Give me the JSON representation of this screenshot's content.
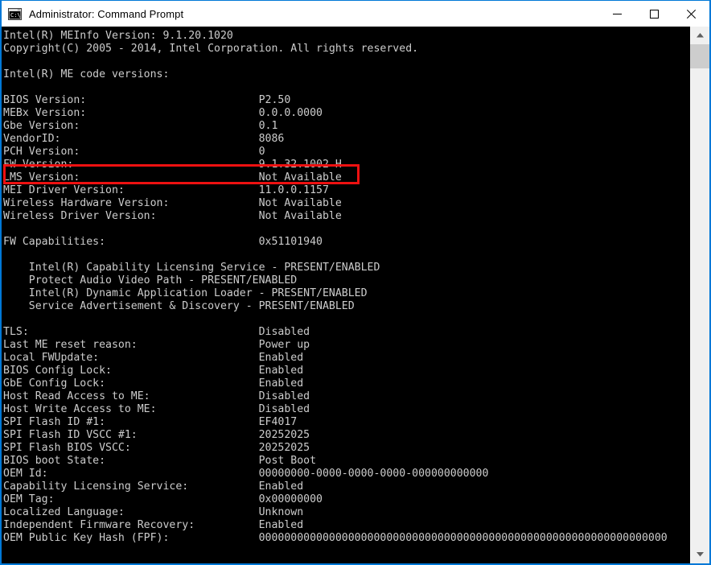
{
  "window": {
    "title": "Administrator: Command Prompt",
    "icon": "command-prompt-icon",
    "border_color": "#0078d7",
    "titlebar_bg": "#ffffff",
    "console_bg": "#000000",
    "console_fg": "#cccccc"
  },
  "caption_buttons": {
    "minimize_label": "Minimize",
    "maximize_label": "Maximize",
    "close_label": "Close"
  },
  "scrollbar": {
    "up_arrow_label": "Scroll up",
    "down_arrow_label": "Scroll down",
    "thumb_label": "Scroll thumb"
  },
  "annotation": {
    "color": "#ee1111",
    "highlighted_line": "FW Version:                           9.1.32.1002 H"
  },
  "console": {
    "text": "Intel(R) MEInfo Version: 9.1.20.1020\nCopyright(C) 2005 - 2014, Intel Corporation. All rights reserved.\n\nIntel(R) ME code versions:\n\nBIOS Version:                           P2.50\nMEBx Version:                           0.0.0.0000\nGbe Version:                            0.1\nVendorID:                               8086\nPCH Version:                            0\nFW Version:                             9.1.32.1002 H\nLMS Version:                            Not Available\nMEI Driver Version:                     11.0.0.1157\nWireless Hardware Version:              Not Available\nWireless Driver Version:                Not Available\n\nFW Capabilities:                        0x51101940\n\n    Intel(R) Capability Licensing Service - PRESENT/ENABLED\n    Protect Audio Video Path - PRESENT/ENABLED\n    Intel(R) Dynamic Application Loader - PRESENT/ENABLED\n    Service Advertisement & Discovery - PRESENT/ENABLED\n\nTLS:                                    Disabled\nLast ME reset reason:                   Power up\nLocal FWUpdate:                         Enabled\nBIOS Config Lock:                       Enabled\nGbE Config Lock:                        Enabled\nHost Read Access to ME:                 Disabled\nHost Write Access to ME:                Disabled\nSPI Flash ID #1:                        EF4017\nSPI Flash ID VSCC #1:                   20252025\nSPI Flash BIOS VSCC:                    20252025\nBIOS boot State:                        Post Boot\nOEM Id:                                 00000000-0000-0000-0000-000000000000\nCapability Licensing Service:           Enabled\nOEM Tag:                                0x00000000\nLocalized Language:                     Unknown\nIndependent Firmware Recovery:          Enabled\nOEM Public Key Hash (FPF):              0000000000000000000000000000000000000000000000000000000000000000"
  }
}
